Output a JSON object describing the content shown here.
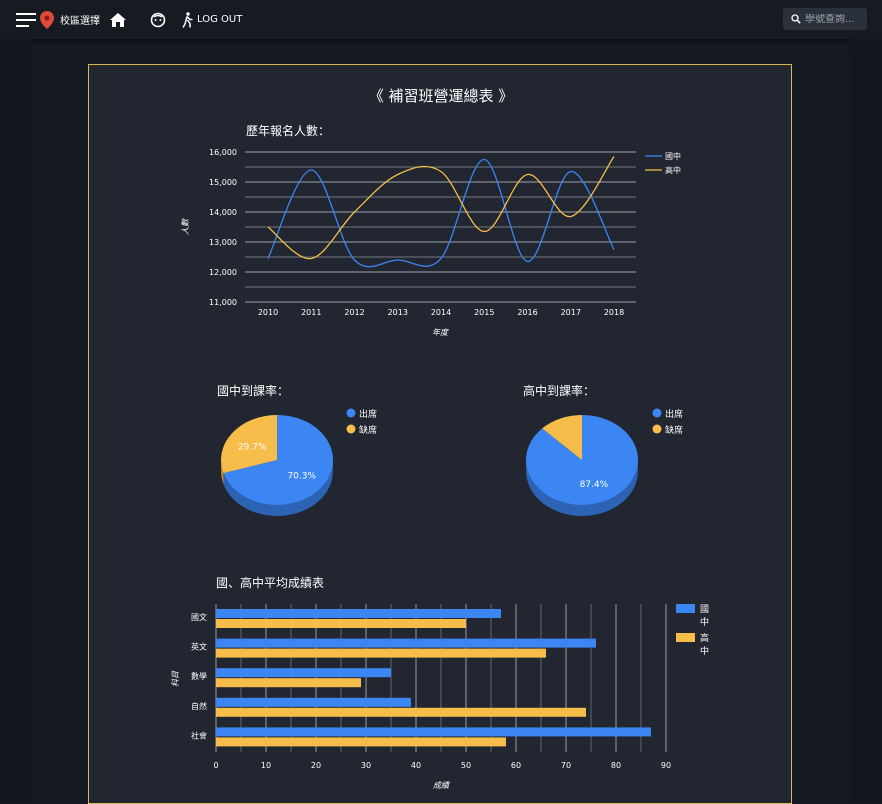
{
  "header": {
    "school_select_label": "校區選擇",
    "logout_label": "LOG OUT",
    "search_placeholder": "學號查詢..."
  },
  "page_title": "《 補習班營運總表 》",
  "colors": {
    "blue": "#3b86f3",
    "yellow": "#f6bd4b",
    "border": "#d8b95a"
  },
  "chart_data": [
    {
      "type": "line",
      "title": "歷年報名人數：",
      "xlabel": "年度",
      "ylabel": "人數",
      "categories": [
        "2010",
        "2011",
        "2012",
        "2013",
        "2014",
        "2015",
        "2016",
        "2017",
        "2018"
      ],
      "ylim": [
        11000,
        16000
      ],
      "yticks": [
        11000,
        12000,
        13000,
        14000,
        15000,
        16000
      ],
      "ytick_labels": [
        "11,000",
        "12,000",
        "13,000",
        "14,000",
        "15,000",
        "16,000"
      ],
      "series": [
        {
          "name": "國中",
          "values": [
            12450,
            15400,
            12400,
            12400,
            12450,
            15750,
            12350,
            15350,
            12750
          ]
        },
        {
          "name": "高中",
          "values": [
            13500,
            12450,
            14000,
            15250,
            15350,
            13350,
            15250,
            13850,
            15850
          ]
        }
      ],
      "legend": "right",
      "grid": true
    },
    {
      "type": "pie",
      "title": "國中到課率：",
      "labels": [
        "出席",
        "缺席"
      ],
      "values": [
        70.3,
        29.7
      ],
      "value_labels": [
        "70.3%",
        "29.7%"
      ],
      "legend": "right"
    },
    {
      "type": "pie",
      "title": "高中到課率：",
      "labels": [
        "出席",
        "缺席"
      ],
      "values": [
        87.4,
        12.6
      ],
      "value_labels": [
        "87.4%",
        ""
      ],
      "legend": "right"
    },
    {
      "type": "bar",
      "orientation": "horizontal",
      "title": "國、高中平均成績表",
      "xlabel": "成績",
      "ylabel": "科目",
      "categories": [
        "國文",
        "英文",
        "數學",
        "自然",
        "社會"
      ],
      "xlim": [
        0,
        90
      ],
      "xticks": [
        0,
        10,
        20,
        30,
        40,
        50,
        60,
        70,
        80,
        90
      ],
      "series": [
        {
          "name": "國中",
          "values": [
            57,
            76,
            35,
            39,
            87
          ]
        },
        {
          "name": "高中",
          "values": [
            50,
            66,
            29,
            74,
            58
          ]
        }
      ],
      "legend": "right",
      "grid": true
    }
  ]
}
